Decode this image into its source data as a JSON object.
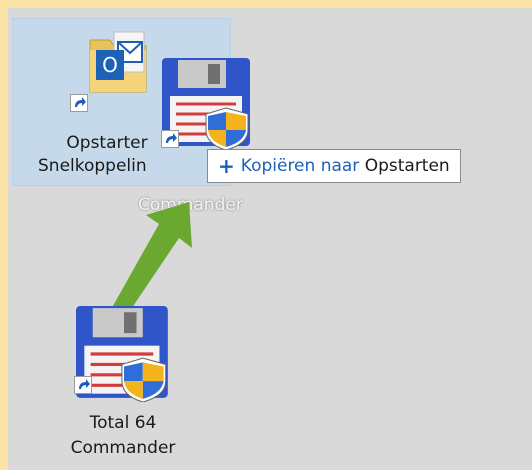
{
  "desktop": {
    "icons": [
      {
        "label_line1": "Opstarter",
        "label_line2": "Snelkoppelin",
        "icon": "outlook-folder-icon",
        "selected": true
      },
      {
        "label_ghost": "Commander",
        "icon": "floppy-shield-icon",
        "dragging": true
      },
      {
        "label_line1": "Total 64",
        "label_line2": "Commander",
        "icon": "floppy-shield-icon"
      }
    ]
  },
  "drag_tooltip": {
    "action": "Kopiëren naar",
    "target": "Opstarten",
    "icon": "plus-icon"
  },
  "annotation": {
    "icon": "green-arrow-icon",
    "color": "#6aa832"
  }
}
